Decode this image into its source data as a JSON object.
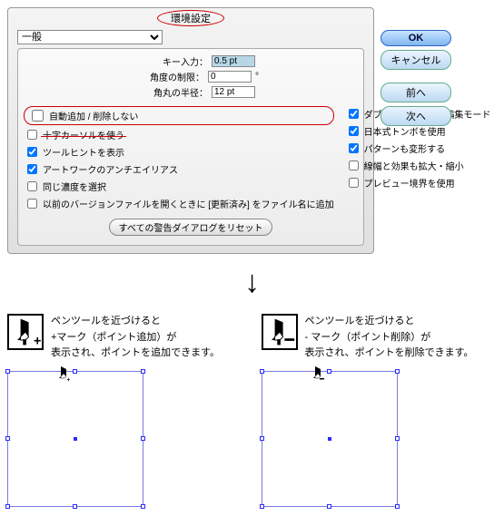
{
  "dialog": {
    "title": "環境設定",
    "section": "一般",
    "fields": {
      "key_input": {
        "label": "キー入力：",
        "value": "0.5 pt"
      },
      "angle_limit": {
        "label": "角度の制限：",
        "value": "0",
        "unit": "°"
      },
      "corner_radius": {
        "label": "角丸の半径：",
        "value": "12 pt"
      }
    },
    "checks_left": [
      {
        "label": "自動追加 / 削除しない",
        "checked": false,
        "highlight": true
      },
      {
        "label": "十字カーソルを使う",
        "checked": false,
        "strike": true
      },
      {
        "label": "ツールヒントを表示",
        "checked": true
      },
      {
        "label": "アートワークのアンチエイリアス",
        "checked": true
      },
      {
        "label": "同じ濃度を選択",
        "checked": false
      },
      {
        "label": "以前のバージョンファイルを開くときに [更新済み] をファイル名に追加",
        "checked": false
      }
    ],
    "checks_right": [
      {
        "label": "ダブルクリックして編集モード",
        "checked": true
      },
      {
        "label": "日本式トンボを使用",
        "checked": true
      },
      {
        "label": "パターンも変形する",
        "checked": true
      },
      {
        "label": "線幅と効果も拡大・縮小",
        "checked": false
      },
      {
        "label": "プレビュー境界を使用",
        "checked": false
      }
    ],
    "reset_button": "すべての警告ダイアログをリセット",
    "buttons": {
      "ok": "OK",
      "cancel": "キャンセル",
      "prev": "前へ",
      "next": "次へ"
    }
  },
  "arrow": "↓",
  "examples": {
    "add": {
      "line1": "ペンツールを近づけると",
      "line2": "+マーク（ポイント追加）が",
      "line3": "表示され、ポイントを追加できます。"
    },
    "del": {
      "line1": "ペンツールを近づけると",
      "line2": "- マーク（ポイント削除）が",
      "line3": "表示され、ポイントを削除できます。"
    }
  }
}
